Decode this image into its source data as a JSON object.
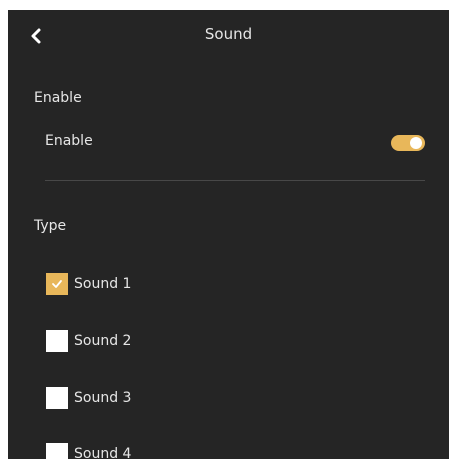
{
  "header": {
    "title": "Sound",
    "back_icon": "chevron-left-icon"
  },
  "enable_section": {
    "heading": "Enable",
    "toggle_label": "Enable",
    "toggle_on": true
  },
  "type_section": {
    "heading": "Type",
    "options": [
      {
        "label": "Sound 1",
        "checked": true
      },
      {
        "label": "Sound 2",
        "checked": false
      },
      {
        "label": "Sound 3",
        "checked": false
      },
      {
        "label": "Sound 4",
        "checked": false
      }
    ]
  },
  "colors": {
    "background": "#252525",
    "accent": "#e8b75a",
    "text": "#e6e6e6"
  }
}
